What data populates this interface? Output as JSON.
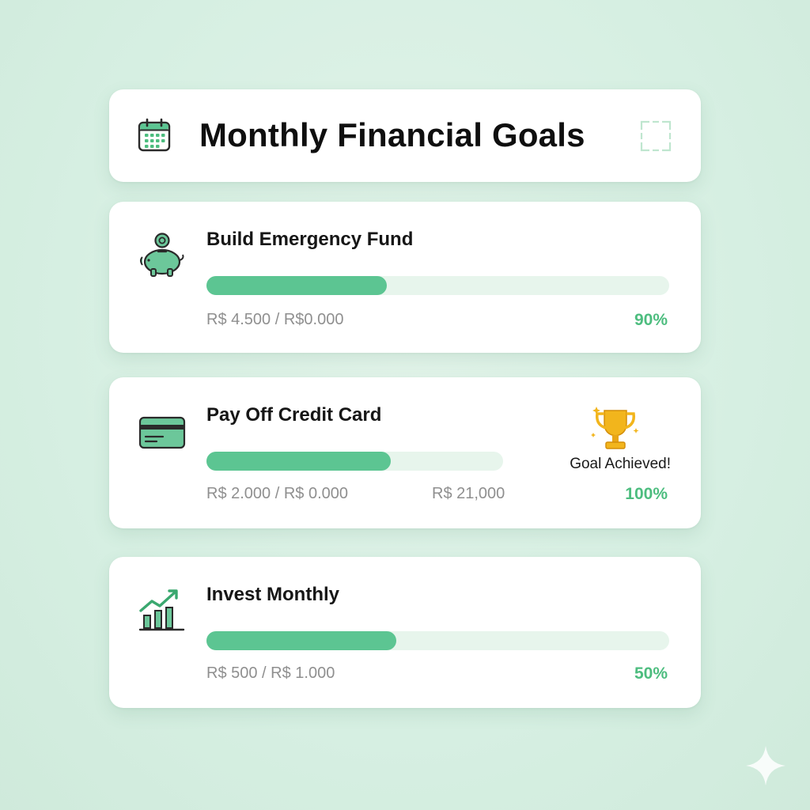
{
  "header": {
    "title": "Monthly Financial Goals",
    "icon": "calendar-icon",
    "action_icon": "expand-icon"
  },
  "goals": [
    {
      "title": "Build Emergency Fund",
      "icon": "piggy-bank-icon",
      "amount": "R$ 4.500 / R$0.000",
      "percent_label": "90%",
      "progress": 0.39
    },
    {
      "title": "Pay Off Credit Card",
      "icon": "credit-card-icon",
      "amount": "R$ 2.000 / R$ 0.000",
      "secondary_amount": "R$ 21,000",
      "achievement_label": "Goal Achieved!",
      "achievement_icon": "trophy-icon",
      "percent_label": "100%",
      "progress": 0.62
    },
    {
      "title": "Invest Monthly",
      "icon": "growth-chart-icon",
      "amount": "R$ 500 / R$ 1.000",
      "percent_label": "50%",
      "progress": 0.41
    }
  ],
  "colors": {
    "accent": "#5cc592",
    "percent": "#4dbd7f",
    "track": "#e7f5ec",
    "trophy": "#f2b51c",
    "background": "#d6efe2"
  }
}
